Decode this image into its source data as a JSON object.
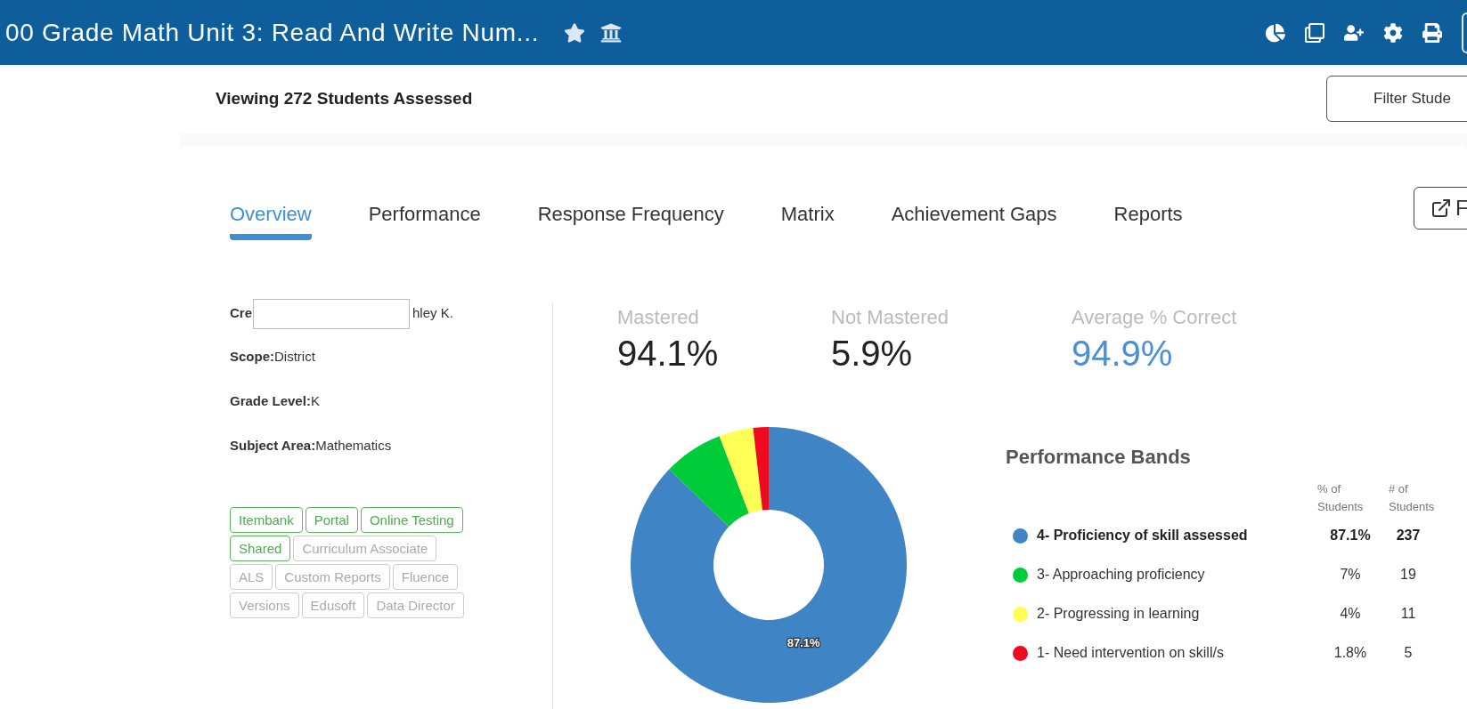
{
  "header": {
    "title": "00 Grade Math Unit 3: Read And Write Num..."
  },
  "viewing": {
    "text": "Viewing 272 Students Assessed",
    "filter_button": "Filter Stude"
  },
  "tabs": [
    {
      "label": "Overview",
      "selected": true
    },
    {
      "label": "Performance",
      "selected": false
    },
    {
      "label": "Response Frequency",
      "selected": false
    },
    {
      "label": "Matrix",
      "selected": false
    },
    {
      "label": "Achievement Gaps",
      "selected": false
    },
    {
      "label": "Reports",
      "selected": false
    }
  ],
  "export_button": "F",
  "info": {
    "creator_label": "Cre",
    "creator_value": "hley K.",
    "fields": [
      {
        "label": "Scope:",
        "value": "District"
      },
      {
        "label": "Grade Level:",
        "value": "K"
      },
      {
        "label": "Subject Area:",
        "value": "Mathematics"
      }
    ]
  },
  "tags": [
    {
      "label": "Itembank",
      "active": true
    },
    {
      "label": "Portal",
      "active": true
    },
    {
      "label": "Online Testing",
      "active": true
    },
    {
      "label": "Shared",
      "active": true
    },
    {
      "label": "Curriculum Associate",
      "active": false
    },
    {
      "label": "ALS",
      "active": false
    },
    {
      "label": "Custom Reports",
      "active": false
    },
    {
      "label": "Fluence",
      "active": false
    },
    {
      "label": "Versions",
      "active": false
    },
    {
      "label": "Edusoft",
      "active": false
    },
    {
      "label": "Data Director",
      "active": false
    }
  ],
  "stats": [
    {
      "label": "Mastered",
      "value": "94.1%",
      "kind": "plain"
    },
    {
      "label": "Not Mastered",
      "value": "5.9%",
      "kind": "plain"
    },
    {
      "label": "Average % Correct",
      "value": "94.9%",
      "kind": "highlight"
    }
  ],
  "chart_data": {
    "type": "donut",
    "categories": [
      "4- Proficiency of skill assessed",
      "3- Approaching proficiency",
      "2- Progressing in learning",
      "1- Need intervention on skill/s"
    ],
    "series": [
      {
        "name": "% of Students",
        "values": [
          87.1,
          7,
          4,
          1.8
        ]
      }
    ],
    "value_labels": [
      "87.1%",
      null,
      null,
      null
    ]
  },
  "bands": {
    "title": "Performance Bands",
    "count_column": "# of Students",
    "rows": [
      {
        "percent": "87.1%",
        "count": "237",
        "color": "#3f84c5",
        "bold": true
      },
      {
        "percent": "7%",
        "count": "19",
        "color": "#00cc3a",
        "bold": false
      },
      {
        "percent": "4%",
        "count": "11",
        "color": "#ffff55",
        "bold": false
      },
      {
        "percent": "1.8%",
        "count": "5",
        "color": "#ee0a1f",
        "bold": false
      }
    ]
  }
}
